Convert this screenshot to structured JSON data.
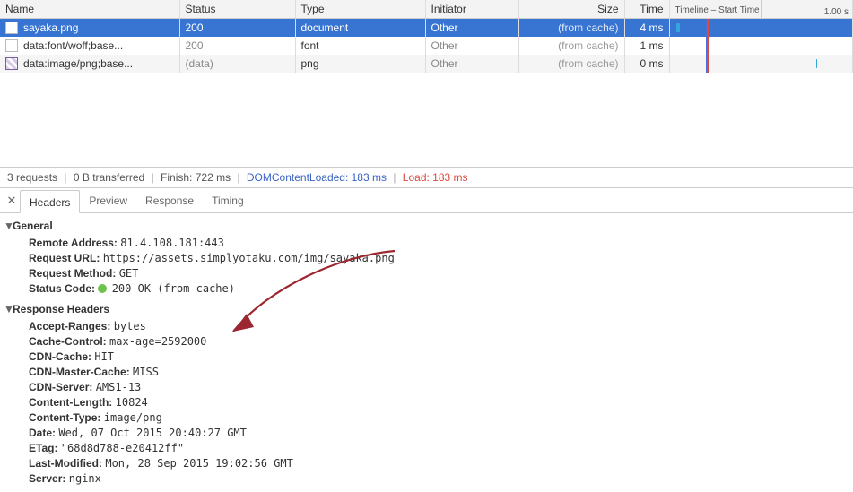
{
  "table": {
    "headers": {
      "name": "Name",
      "status": "Status",
      "type": "Type",
      "initiator": "Initiator",
      "size": "Size",
      "time": "Time",
      "timeline": "Timeline – Start Time",
      "timeline_end": "1.00 s"
    },
    "rows": [
      {
        "selected": true,
        "icon": "doc",
        "name": "sayaka.png",
        "status": "200",
        "type": "document",
        "initiator": "Other",
        "size": "(from cache)",
        "time": "4 ms",
        "bars": [
          {
            "left_pct": 1,
            "width_pct": 2,
            "color": "#33a6dd"
          }
        ]
      },
      {
        "selected": false,
        "icon": "doc",
        "name": "data:font/woff;base...",
        "status": "200",
        "type": "font",
        "initiator": "Other",
        "size": "(from cache)",
        "time": "1 ms",
        "bars": [
          {
            "left_pct": 18,
            "width_pct": 1,
            "color": "#33a6dd"
          }
        ]
      },
      {
        "selected": false,
        "icon": "img",
        "name": "data:image/png;base...",
        "status": "(data)",
        "type": "png",
        "initiator": "Other",
        "size": "(from cache)",
        "time": "0 ms",
        "bars": [
          {
            "left_pct": 82,
            "width_pct": 1,
            "color": "#33a6dd"
          }
        ]
      }
    ],
    "dom_line_pct": 18,
    "load_line_pct": 18.7
  },
  "status": {
    "requests": "3 requests",
    "transferred": "0 B transferred",
    "finish": "Finish: 722 ms",
    "dcl": "DOMContentLoaded: 183 ms",
    "load": "Load: 183 ms"
  },
  "tabs": [
    "Headers",
    "Preview",
    "Response",
    "Timing"
  ],
  "active_tab": 0,
  "general": {
    "title": "General",
    "remote_address": {
      "k": "Remote Address:",
      "v": "81.4.108.181:443"
    },
    "request_url": {
      "k": "Request URL:",
      "v": "https://assets.simplyotaku.com/img/sayaka.png"
    },
    "request_method": {
      "k": "Request Method:",
      "v": "GET"
    },
    "status_code": {
      "k": "Status Code:",
      "v": "200 OK (from cache)"
    }
  },
  "response_headers": {
    "title": "Response Headers",
    "items": [
      {
        "k": "Accept-Ranges:",
        "v": "bytes"
      },
      {
        "k": "Cache-Control:",
        "v": "max-age=2592000"
      },
      {
        "k": "CDN-Cache:",
        "v": "HIT"
      },
      {
        "k": "CDN-Master-Cache:",
        "v": "MISS"
      },
      {
        "k": "CDN-Server:",
        "v": "AMS1-13"
      },
      {
        "k": "Content-Length:",
        "v": "10824"
      },
      {
        "k": "Content-Type:",
        "v": "image/png"
      },
      {
        "k": "Date:",
        "v": "Wed, 07 Oct 2015 20:40:27 GMT"
      },
      {
        "k": "ETag:",
        "v": "\"68d8d788-e20412ff\""
      },
      {
        "k": "Last-Modified:",
        "v": "Mon, 28 Sep 2015 19:02:56 GMT"
      },
      {
        "k": "Server:",
        "v": "nginx"
      }
    ]
  }
}
